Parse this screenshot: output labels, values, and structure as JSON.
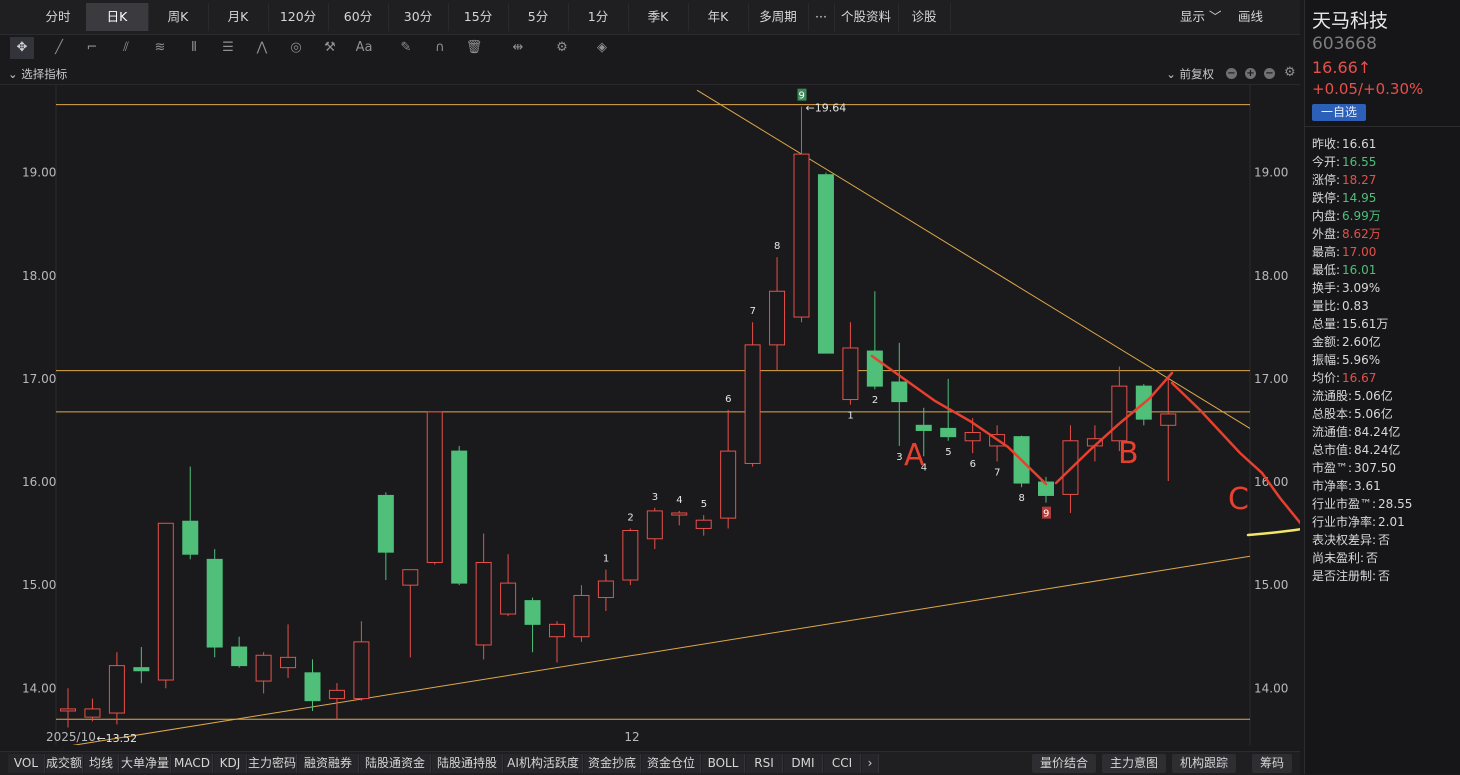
{
  "tabs": [
    "分时",
    "日K",
    "周K",
    "月K",
    "120分",
    "60分",
    "30分",
    "15分",
    "5分",
    "1分",
    "季K",
    "年K",
    "多周期",
    "···",
    "个股资料",
    "诊股"
  ],
  "active_tab": "日K",
  "top_right": {
    "display": "显示 ﹀",
    "draw": "画线"
  },
  "indicator_bar": {
    "select": "⌄ 选择指标",
    "adjust": "⌄ 前复权"
  },
  "stock": {
    "name": "天马科技",
    "code": "603668",
    "price": "16.66↑",
    "change": "+0.05/+0.30%",
    "watch_button": "一自选"
  },
  "stats": [
    {
      "label": "昨收:",
      "value": "16.61",
      "color": "#d8d8d8"
    },
    {
      "label": "今开:",
      "value": "16.55",
      "color": "#4fbf7a"
    },
    {
      "label": "涨停:",
      "value": "18.27",
      "color": "#e7504a"
    },
    {
      "label": "跌停:",
      "value": "14.95",
      "color": "#4fbf7a"
    },
    {
      "label": "内盘:",
      "value": "6.99万",
      "color": "#4fbf7a"
    },
    {
      "label": "外盘:",
      "value": "8.62万",
      "color": "#e7504a"
    },
    {
      "label": "最高:",
      "value": "17.00",
      "color": "#e7504a"
    },
    {
      "label": "最低:",
      "value": "16.01",
      "color": "#4fbf7a"
    },
    {
      "label": "换手:",
      "value": "3.09%",
      "color": "#d8d8d8"
    },
    {
      "label": "量比:",
      "value": "0.83",
      "color": "#d8d8d8"
    },
    {
      "label": "总量:",
      "value": "15.61万",
      "color": "#d8d8d8"
    },
    {
      "label": "金额:",
      "value": "2.60亿",
      "color": "#d8d8d8"
    },
    {
      "label": "振幅:",
      "value": "5.96%",
      "color": "#d8d8d8"
    },
    {
      "label": "均价:",
      "value": "16.67",
      "color": "#e7504a"
    },
    {
      "label": "流通股:",
      "value": "5.06亿",
      "color": "#d8d8d8"
    },
    {
      "label": "总股本:",
      "value": "5.06亿",
      "color": "#d8d8d8"
    },
    {
      "label": "流通值:",
      "value": "84.24亿",
      "color": "#d8d8d8"
    },
    {
      "label": "总市值:",
      "value": "84.24亿",
      "color": "#d8d8d8"
    },
    {
      "label": "市盈™:",
      "value": "307.50",
      "color": "#d8d8d8"
    },
    {
      "label": "市净率:",
      "value": "3.61",
      "color": "#d8d8d8"
    },
    {
      "label": "行业市盈™:",
      "value": "28.55",
      "color": "#d8d8d8"
    },
    {
      "label": "行业市净率:",
      "value": "2.01",
      "color": "#d8d8d8"
    },
    {
      "label": "表决权差异:",
      "value": "否",
      "color": "#d8d8d8"
    },
    {
      "label": "尚未盈利:",
      "value": "否",
      "color": "#d8d8d8"
    },
    {
      "label": "是否注册制:",
      "value": "否",
      "color": "#d8d8d8"
    }
  ],
  "bottom_tabs": [
    "VOL",
    "成交额",
    "均线",
    "大单净量",
    "MACD",
    "KDJ",
    "主力密码",
    "融资融券",
    "陆股通资金",
    "陆股通持股",
    "AI机构活跃度",
    "资金抄底",
    "资金仓位",
    "BOLL",
    "RSI",
    "DMI",
    "CCI"
  ],
  "bottom_right": [
    "量价结合",
    "主力意图",
    "机构跟踪",
    "筹码"
  ],
  "chart_data": {
    "type": "candlestick",
    "ylim": [
      13.45,
      19.85
    ],
    "y_ticks": [
      14.0,
      15.0,
      16.0,
      17.0,
      18.0,
      19.0
    ],
    "y_tick_labels": [
      "14.00",
      "15.00",
      "16.00",
      "17.00",
      "18.00",
      "19.00"
    ],
    "x_labels": [
      {
        "index": 0,
        "text": "2025/10"
      },
      {
        "index": 23,
        "text": "12"
      }
    ],
    "candles": [
      {
        "o": 13.78,
        "h": 14.0,
        "l": 13.62,
        "c": 13.8
      },
      {
        "o": 13.72,
        "h": 13.9,
        "l": 13.68,
        "c": 13.8
      },
      {
        "o": 13.76,
        "h": 14.35,
        "l": 13.65,
        "c": 14.22
      },
      {
        "o": 14.2,
        "h": 14.4,
        "l": 14.05,
        "c": 14.17
      },
      {
        "o": 14.08,
        "h": 15.6,
        "l": 14.0,
        "c": 15.6
      },
      {
        "o": 15.62,
        "h": 16.15,
        "l": 15.25,
        "c": 15.3
      },
      {
        "o": 15.25,
        "h": 15.35,
        "l": 14.3,
        "c": 14.4
      },
      {
        "o": 14.4,
        "h": 14.5,
        "l": 14.2,
        "c": 14.22
      },
      {
        "o": 14.07,
        "h": 14.35,
        "l": 13.95,
        "c": 14.32
      },
      {
        "o": 14.2,
        "h": 14.62,
        "l": 14.1,
        "c": 14.3
      },
      {
        "o": 14.15,
        "h": 14.28,
        "l": 13.78,
        "c": 13.88
      },
      {
        "o": 13.9,
        "h": 14.05,
        "l": 13.7,
        "c": 13.98
      },
      {
        "o": 13.9,
        "h": 14.65,
        "l": 13.88,
        "c": 14.45
      },
      {
        "o": 15.87,
        "h": 15.9,
        "l": 15.05,
        "c": 15.32
      },
      {
        "o": 15.0,
        "h": 15.15,
        "l": 14.3,
        "c": 15.15
      },
      {
        "o": 15.22,
        "h": 16.68,
        "l": 15.2,
        "c": 16.68
      },
      {
        "o": 16.3,
        "h": 16.35,
        "l": 15.0,
        "c": 15.02
      },
      {
        "o": 14.42,
        "h": 15.5,
        "l": 14.28,
        "c": 15.22
      },
      {
        "o": 14.72,
        "h": 15.3,
        "l": 14.7,
        "c": 15.02
      },
      {
        "o": 14.85,
        "h": 14.88,
        "l": 14.35,
        "c": 14.62
      },
      {
        "o": 14.5,
        "h": 14.65,
        "l": 14.25,
        "c": 14.62
      },
      {
        "o": 14.5,
        "h": 15.0,
        "l": 14.45,
        "c": 14.9
      },
      {
        "o": 14.88,
        "h": 15.15,
        "l": 14.75,
        "c": 15.04
      },
      {
        "o": 15.05,
        "h": 15.55,
        "l": 15.0,
        "c": 15.53
      },
      {
        "o": 15.45,
        "h": 15.75,
        "l": 15.35,
        "c": 15.72
      },
      {
        "o": 15.68,
        "h": 15.72,
        "l": 15.58,
        "c": 15.7
      },
      {
        "o": 15.55,
        "h": 15.68,
        "l": 15.48,
        "c": 15.63
      },
      {
        "o": 15.65,
        "h": 16.7,
        "l": 15.55,
        "c": 16.3
      },
      {
        "o": 16.18,
        "h": 17.55,
        "l": 16.15,
        "c": 17.33
      },
      {
        "o": 17.33,
        "h": 18.18,
        "l": 17.08,
        "c": 17.85
      },
      {
        "o": 17.6,
        "h": 19.64,
        "l": 17.55,
        "c": 19.18
      },
      {
        "o": 18.98,
        "h": 19.0,
        "l": 17.25,
        "c": 17.25
      },
      {
        "o": 16.8,
        "h": 17.55,
        "l": 16.75,
        "c": 17.3
      },
      {
        "o": 17.27,
        "h": 17.85,
        "l": 16.9,
        "c": 16.93
      },
      {
        "o": 16.97,
        "h": 17.35,
        "l": 16.35,
        "c": 16.78
      },
      {
        "o": 16.55,
        "h": 16.72,
        "l": 16.25,
        "c": 16.5
      },
      {
        "o": 16.52,
        "h": 17.0,
        "l": 16.4,
        "c": 16.44
      },
      {
        "o": 16.4,
        "h": 16.62,
        "l": 16.28,
        "c": 16.48
      },
      {
        "o": 16.35,
        "h": 16.55,
        "l": 16.2,
        "c": 16.46
      },
      {
        "o": 16.44,
        "h": 16.45,
        "l": 15.95,
        "c": 15.99
      },
      {
        "o": 16.0,
        "h": 16.05,
        "l": 15.8,
        "c": 15.87
      },
      {
        "o": 15.88,
        "h": 16.55,
        "l": 15.7,
        "c": 16.4
      },
      {
        "o": 16.35,
        "h": 16.55,
        "l": 16.2,
        "c": 16.42
      },
      {
        "o": 16.4,
        "h": 17.12,
        "l": 16.3,
        "c": 16.93
      },
      {
        "o": 16.93,
        "h": 16.95,
        "l": 16.55,
        "c": 16.61
      },
      {
        "o": 16.55,
        "h": 17.0,
        "l": 16.01,
        "c": 16.66
      }
    ],
    "seq_labels": [
      {
        "i": 22,
        "t": "1",
        "pos": "above"
      },
      {
        "i": 23,
        "t": "2",
        "pos": "above"
      },
      {
        "i": 24,
        "t": "3",
        "pos": "above"
      },
      {
        "i": 25,
        "t": "4",
        "pos": "above"
      },
      {
        "i": 26,
        "t": "5",
        "pos": "above"
      },
      {
        "i": 27,
        "t": "6",
        "pos": "above"
      },
      {
        "i": 28,
        "t": "7",
        "pos": "above"
      },
      {
        "i": 29,
        "t": "8",
        "pos": "above"
      },
      {
        "i": 30,
        "t": "9",
        "pos": "top-box"
      },
      {
        "i": 32,
        "t": "1",
        "pos": "below"
      },
      {
        "i": 33,
        "t": "2",
        "pos": "below"
      },
      {
        "i": 34,
        "t": "3",
        "pos": "below"
      },
      {
        "i": 35,
        "t": "4",
        "pos": "below"
      },
      {
        "i": 36,
        "t": "5",
        "pos": "below"
      },
      {
        "i": 37,
        "t": "6",
        "pos": "below"
      },
      {
        "i": 38,
        "t": "7",
        "pos": "below"
      },
      {
        "i": 39,
        "t": "8",
        "pos": "below"
      },
      {
        "i": 40,
        "t": "9",
        "pos": "bottom-box"
      }
    ],
    "high_label": "←19.64",
    "low_label": "←13.52",
    "annotations": {
      "A": "A",
      "B": "B",
      "C": "C"
    },
    "h_lines": [
      19.66,
      17.08,
      16.68,
      13.7
    ],
    "colors": {
      "up": "#e7504a",
      "down": "#4fbf7a",
      "line": "#e0a94a",
      "draw": "#e8402f",
      "yellow": "#f0e66a"
    }
  }
}
